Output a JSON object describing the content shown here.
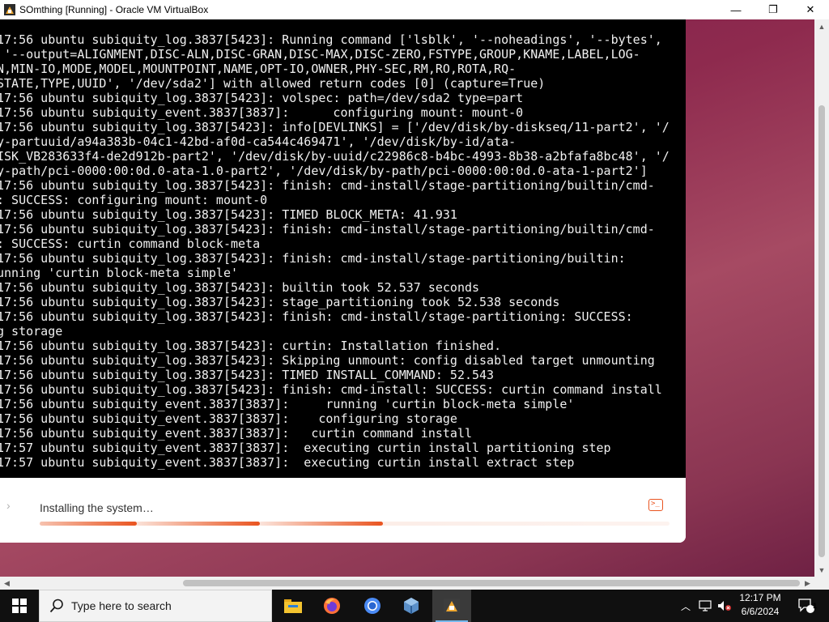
{
  "window": {
    "title": "SOmthing [Running] - Oracle VM VirtualBox",
    "minimize_glyph": "—",
    "maximize_glyph": "❐",
    "close_glyph": "✕"
  },
  "terminal": {
    "lines": [
      "17:56 ubuntu subiquity_log.3837[5423]: Running command ['lsblk', '--noheadings', '--bytes',",
      " '--output=ALIGNMENT,DISC-ALN,DISC-GRAN,DISC-MAX,DISC-ZERO,FSTYPE,GROUP,KNAME,LABEL,LOG-",
      "N,MIN-IO,MODE,MODEL,MOUNTPOINT,NAME,OPT-IO,OWNER,PHY-SEC,RM,RO,ROTA,RQ-",
      "STATE,TYPE,UUID', '/dev/sda2'] with allowed return codes [0] (capture=True)",
      "17:56 ubuntu subiquity_log.3837[5423]: volspec: path=/dev/sda2 type=part",
      "17:56 ubuntu subiquity_event.3837[3837]:      configuring mount: mount-0",
      "17:56 ubuntu subiquity_log.3837[5423]: info[DEVLINKS] = ['/dev/disk/by-diskseq/11-part2', '/",
      "y-partuuid/a94a383b-04c1-42bd-af0d-ca544c469471', '/dev/disk/by-id/ata-",
      "ISK_VB283633f4-de2d912b-part2', '/dev/disk/by-uuid/c22986c8-b4bc-4993-8b38-a2bfafa8bc48', '/",
      "y-path/pci-0000:00:0d.0-ata-1.0-part2', '/dev/disk/by-path/pci-0000:00:0d.0-ata-1-part2']",
      "17:56 ubuntu subiquity_log.3837[5423]: finish: cmd-install/stage-partitioning/builtin/cmd-",
      ": SUCCESS: configuring mount: mount-0",
      "17:56 ubuntu subiquity_log.3837[5423]: TIMED BLOCK_META: 41.931",
      "17:56 ubuntu subiquity_log.3837[5423]: finish: cmd-install/stage-partitioning/builtin/cmd-",
      ": SUCCESS: curtin command block-meta",
      "17:56 ubuntu subiquity_log.3837[5423]: finish: cmd-install/stage-partitioning/builtin:",
      "unning 'curtin block-meta simple'",
      "17:56 ubuntu subiquity_log.3837[5423]: builtin took 52.537 seconds",
      "17:56 ubuntu subiquity_log.3837[5423]: stage_partitioning took 52.538 seconds",
      "17:56 ubuntu subiquity_log.3837[5423]: finish: cmd-install/stage-partitioning: SUCCESS:",
      "g storage",
      "17:56 ubuntu subiquity_log.3837[5423]: curtin: Installation finished.",
      "17:56 ubuntu subiquity_log.3837[5423]: Skipping unmount: config disabled target unmounting",
      "17:56 ubuntu subiquity_log.3837[5423]: TIMED INSTALL_COMMAND: 52.543",
      "17:56 ubuntu subiquity_log.3837[5423]: finish: cmd-install: SUCCESS: curtin command install",
      "17:56 ubuntu subiquity_event.3837[3837]:     running 'curtin block-meta simple'",
      "17:56 ubuntu subiquity_event.3837[3837]:    configuring storage",
      "17:56 ubuntu subiquity_event.3837[3837]:   curtin command install",
      "17:57 ubuntu subiquity_event.3837[3837]:  executing curtin install partitioning step",
      "17:57 ubuntu subiquity_event.3837[3837]:  executing curtin install extract step"
    ]
  },
  "installer": {
    "status_label": "Installing the system…",
    "accent_color": "#e95420",
    "progress_icon": "chevron-right-icon",
    "terminal_icon": "terminal-icon"
  },
  "taskbar": {
    "search_placeholder": "Type here to search",
    "apps": [
      "file-explorer-icon",
      "firefox-icon",
      "chrome-icon",
      "virtualbox-icon",
      "virtualbox-vm-icon"
    ],
    "clock_time": "12:17 PM",
    "clock_date": "6/6/2024",
    "notification_count": "1"
  }
}
